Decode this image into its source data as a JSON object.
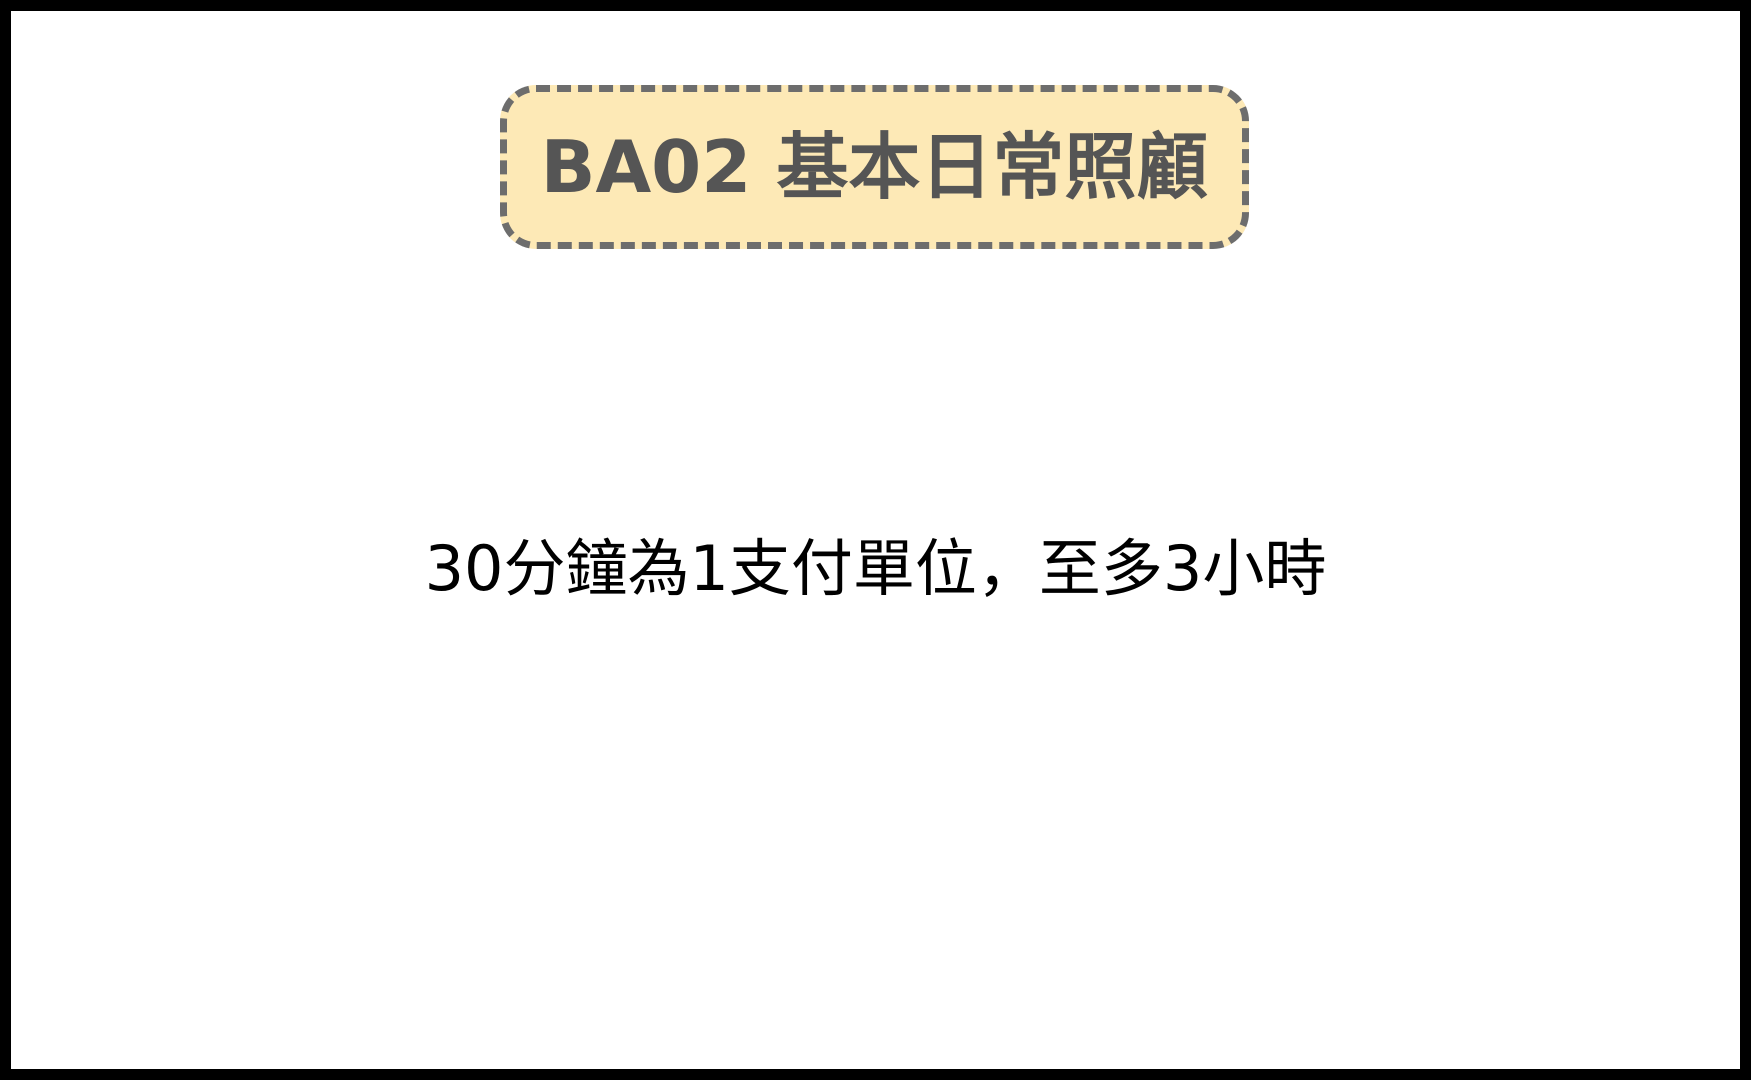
{
  "slide": {
    "title": "BA02 基本日常照顧",
    "body": "30分鐘為1支付單位，至多3小時"
  },
  "colors": {
    "background_frame": "#000000",
    "slide_background": "#ffffff",
    "title_fill": "#fde9b6",
    "title_border": "#6d6d6d",
    "title_text": "#555555",
    "body_text": "#000000"
  }
}
